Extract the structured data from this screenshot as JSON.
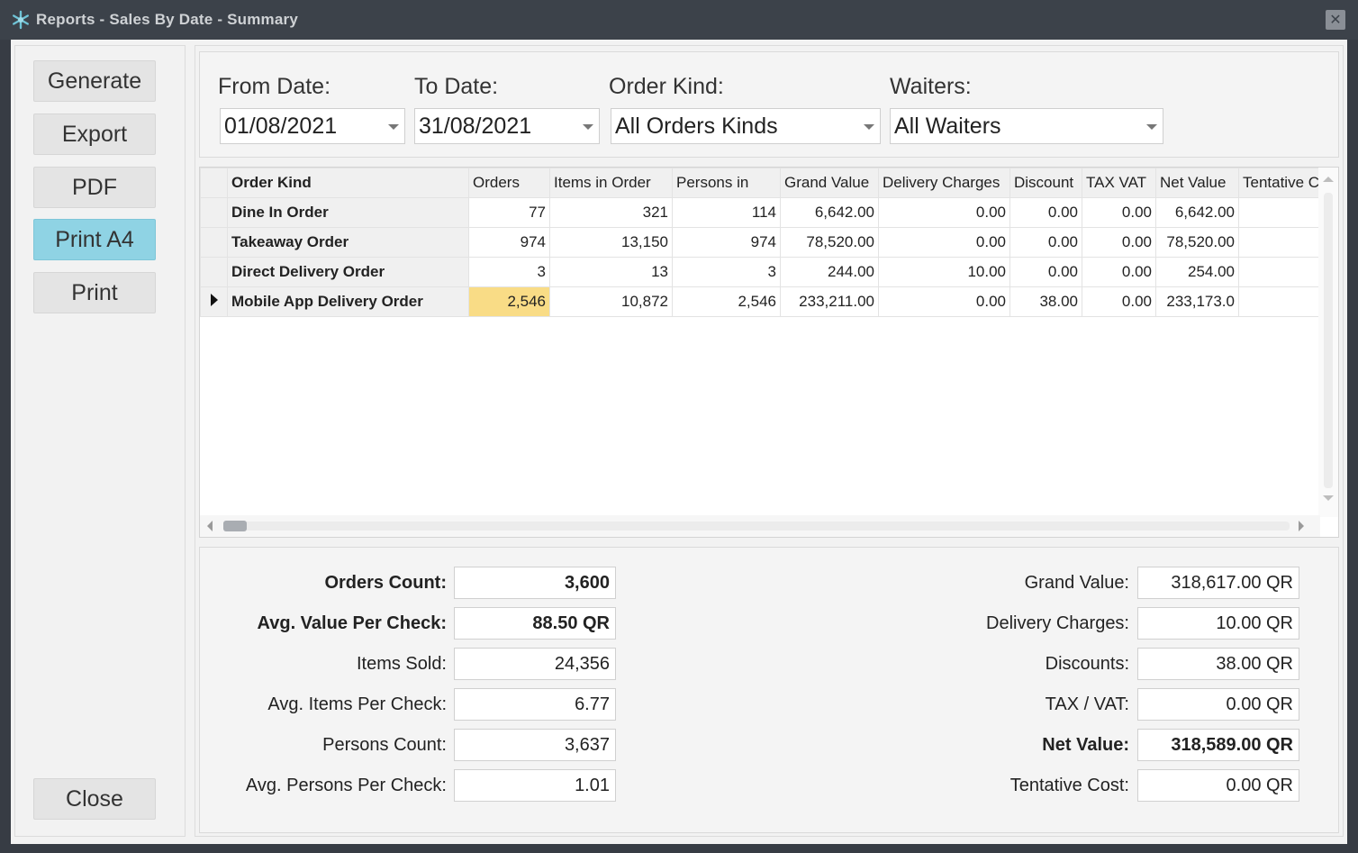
{
  "window": {
    "title": "Reports - Sales By Date - Summary",
    "close_glyph": "✕"
  },
  "sidebar": {
    "generate": "Generate",
    "export": "Export",
    "pdf": "PDF",
    "print_a4": "Print A4",
    "print": "Print",
    "close": "Close"
  },
  "filters": {
    "from_label": "From Date:",
    "from_value": "01/08/2021",
    "to_label": "To Date:",
    "to_value": "31/08/2021",
    "kind_label": "Order Kind:",
    "kind_value": "All Orders Kinds",
    "waiters_label": "Waiters:",
    "waiters_value": "All Waiters"
  },
  "grid": {
    "columns": [
      "Order Kind",
      "Orders",
      "Items in Order",
      "Persons in",
      "Grand Value",
      "Delivery Charges",
      "Discount",
      "TAX  VAT",
      "Net Value",
      "Tentative C"
    ],
    "rows": [
      {
        "kind": "Dine In Order",
        "orders": "77",
        "items": "321",
        "persons": "114",
        "grand": "6,642.00",
        "delivery": "0.00",
        "discount": "0.00",
        "tax": "0.00",
        "net": "6,642.00",
        "tentative": ""
      },
      {
        "kind": "Takeaway Order",
        "orders": "974",
        "items": "13,150",
        "persons": "974",
        "grand": "78,520.00",
        "delivery": "0.00",
        "discount": "0.00",
        "tax": "0.00",
        "net": "78,520.00",
        "tentative": ""
      },
      {
        "kind": "Direct Delivery Order",
        "orders": "3",
        "items": "13",
        "persons": "3",
        "grand": "244.00",
        "delivery": "10.00",
        "discount": "0.00",
        "tax": "0.00",
        "net": "254.00",
        "tentative": ""
      },
      {
        "kind": "Mobile App Delivery Order",
        "orders": "2,546",
        "items": "10,872",
        "persons": "2,546",
        "grand": "233,211.00",
        "delivery": "0.00",
        "discount": "38.00",
        "tax": "0.00",
        "net": "233,173.0",
        "tentative": ""
      }
    ],
    "highlight_color": "#f9dc86"
  },
  "summary": {
    "orders_count_label": "Orders Count:",
    "orders_count": "3,600",
    "avg_value_label": "Avg. Value Per Check:",
    "avg_value": "88.50 QR",
    "items_sold_label": "Items Sold:",
    "items_sold": "24,356",
    "avg_items_label": "Avg. Items Per Check:",
    "avg_items": "6.77",
    "persons_count_label": "Persons Count:",
    "persons_count": "3,637",
    "avg_persons_label": "Avg. Persons Per Check:",
    "avg_persons": "1.01",
    "grand_value_label": "Grand Value:",
    "grand_value": "318,617.00 QR",
    "delivery_label": "Delivery Charges:",
    "delivery": "10.00 QR",
    "discounts_label": "Discounts:",
    "discounts": "38.00 QR",
    "tax_label": "TAX / VAT:",
    "tax": "0.00 QR",
    "net_value_label": "Net Value:",
    "net_value": "318,589.00 QR",
    "tentative_label": "Tentative Cost:",
    "tentative": "0.00 QR"
  },
  "colors": {
    "titlebar": "#3c424a",
    "active_button": "#8fd3e4"
  }
}
